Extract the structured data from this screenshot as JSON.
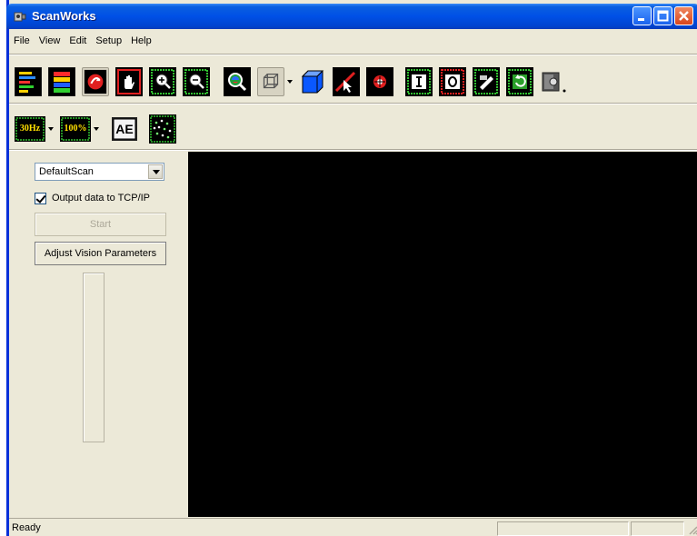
{
  "window": {
    "title": "ScanWorks",
    "app_icon": "scanner-icon"
  },
  "title_buttons": [
    "minimize-icon",
    "maximize-icon",
    "close-icon"
  ],
  "menu": [
    "File",
    "View",
    "Edit",
    "Setup",
    "Help"
  ],
  "toolbar1": [
    "colored-bars-icon",
    "color-stack-icon",
    "rotate-view-icon",
    "pan-hand-icon",
    "zoom-in-icon",
    "zoom-out-icon",
    "zoom-fit-icon",
    "wireframe-cube-icon",
    "solid-cube-icon",
    "pointer-icon",
    "target-icon",
    "input-icon",
    "output-icon",
    "paint-icon",
    "undo-icon",
    "camera-icon"
  ],
  "toolbar2": {
    "rate_label": "30Hz",
    "percent_label": "100%",
    "ae_label": "AE",
    "points_icon": "point-cloud-icon"
  },
  "panel": {
    "scan_select": "DefaultScan",
    "tcp_checkbox_label": "Output data to TCP/IP",
    "tcp_checked": true,
    "start_label": "Start",
    "adjust_label": "Adjust Vision Parameters"
  },
  "status": {
    "text": "Ready"
  },
  "colors": {
    "title_blue": "#0050e6",
    "viewport": "#000000",
    "chrome": "#ece9d8"
  }
}
